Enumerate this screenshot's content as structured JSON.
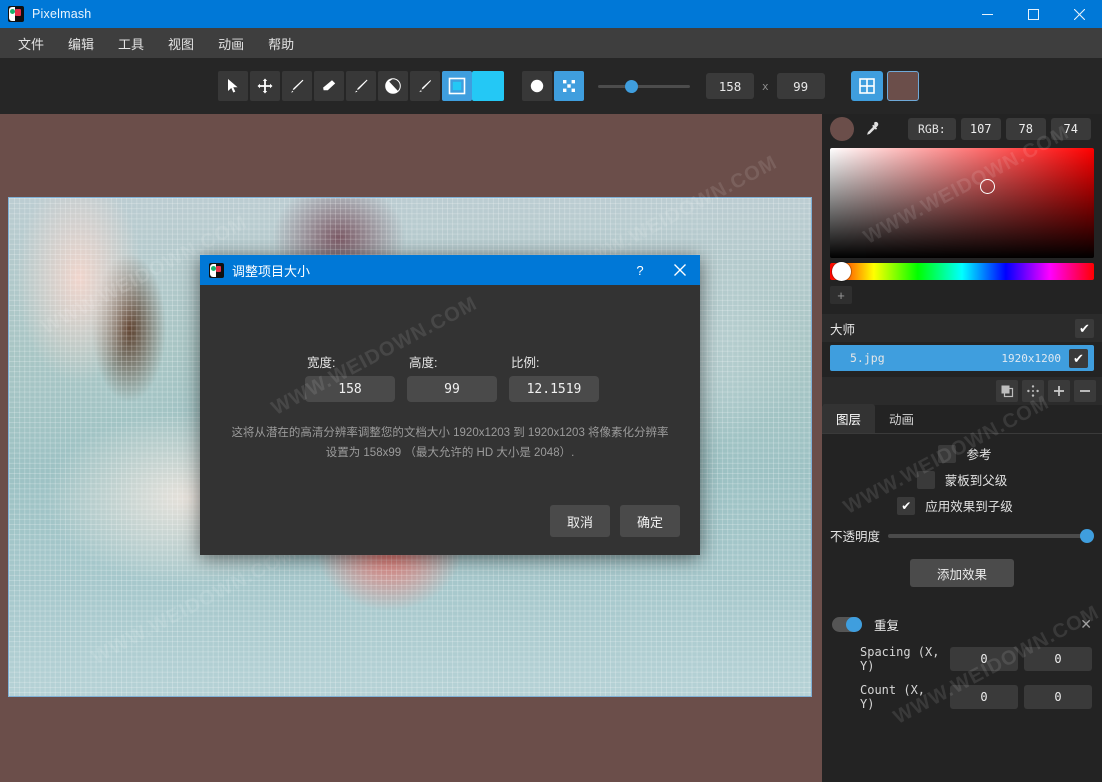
{
  "window": {
    "title": "Pixelmash",
    "minimize": "–",
    "maximize": "□",
    "close": "✕"
  },
  "menubar": {
    "items": [
      {
        "label": "文件"
      },
      {
        "label": "编辑"
      },
      {
        "label": "工具"
      },
      {
        "label": "视图"
      },
      {
        "label": "动画"
      },
      {
        "label": "帮助"
      }
    ]
  },
  "toolbar": {
    "tools": [
      {
        "name": "select-arrow-tool",
        "icon": "cursor-arrow-icon"
      },
      {
        "name": "move-tool",
        "icon": "move-arrows-icon"
      },
      {
        "name": "pencil-tool",
        "icon": "pencil-icon"
      },
      {
        "name": "eraser-tool",
        "icon": "eraser-icon"
      },
      {
        "name": "brush-tool",
        "icon": "brush-icon"
      },
      {
        "name": "paint-bucket-tool",
        "icon": "paint-bucket-icon"
      },
      {
        "name": "smudge-tool",
        "icon": "smudge-brush-icon"
      }
    ],
    "shape_tool": "square-outline-icon",
    "foreground_color": "#24c8f5",
    "circle_tool": "filled-circle-icon",
    "dither_tool": "dither-pattern-icon",
    "brush_size_slider_value": 30,
    "width_value": "158",
    "x_separator": "x",
    "height_value": "99",
    "grid_toggle_icon": "grid-icon",
    "background_color": "#6b4e4a"
  },
  "color_panel": {
    "current_color": "#6b4e4a",
    "eyedropper_icon": "eyedropper-icon",
    "mode_label": "RGB:",
    "r": "107",
    "g": "78",
    "b": "74",
    "add_swatch_label": "+"
  },
  "layers": {
    "rows": [
      {
        "name": "大师",
        "dimensions": "",
        "visible": "✔",
        "selected": false
      },
      {
        "name": "5.jpg",
        "dimensions": "1920x1200",
        "visible": "✔",
        "selected": true
      }
    ],
    "actions": [
      {
        "name": "duplicate-layer-button",
        "icon": "duplicate-icon"
      },
      {
        "name": "move-layer-button",
        "icon": "move-dots-icon"
      },
      {
        "name": "add-layer-button",
        "icon": "plus-icon",
        "glyph": "+"
      },
      {
        "name": "remove-layer-button",
        "icon": "minus-icon",
        "glyph": "−"
      }
    ]
  },
  "panel_tabs": [
    {
      "label": "图层",
      "active": true
    },
    {
      "label": "动画",
      "active": false
    }
  ],
  "layer_options": {
    "reference": {
      "label": "参考",
      "checked": false,
      "mark": ""
    },
    "mask_to_parent": {
      "label": "蒙板到父级",
      "checked": false,
      "mark": ""
    },
    "apply_effects_to_children": {
      "label": "应用效果到子级",
      "checked": true,
      "mark": "✔"
    },
    "opacity_label": "不透明度",
    "opacity_value": 100,
    "add_effect_label": "添加效果"
  },
  "effect": {
    "enabled": true,
    "title": "重复",
    "close_glyph": "✕",
    "rows": [
      {
        "label": "Spacing (X, Y)",
        "x": "0",
        "y": "0"
      },
      {
        "label": "Count (X, Y)",
        "x": "0",
        "y": "0"
      }
    ]
  },
  "dialog": {
    "title": "调整项目大小",
    "help_glyph": "?",
    "close_glyph": "✕",
    "fields": [
      {
        "label": "宽度:",
        "value": "158"
      },
      {
        "label": "高度:",
        "value": "99"
      },
      {
        "label": "比例:",
        "value": "12.1519"
      }
    ],
    "description": "这将从潜在的高清分辨率调整您的文档大小 1920x1203 到 1920x1203 将像素化分辨率设置为 158x99 （最大允许的 HD 大小是 2048）.",
    "cancel_label": "取消",
    "ok_label": "确定"
  },
  "canvas": {
    "background_color": "#6b4e4a",
    "border_color": "#7fb0d6",
    "grid_visible": true
  },
  "watermarks": [
    "WWW.WEIDOWN.COM",
    "WWW.WEIDOWN.COM",
    "WWW.WEIDOWN.COM",
    "WWW.WEIDOWN.COM",
    "WWW.WEIDOWN.COM",
    "WWW.WEIDOWN.COM",
    "WWW.WEIDOWN.COM",
    "WWW.WEIDOWN.COM"
  ]
}
